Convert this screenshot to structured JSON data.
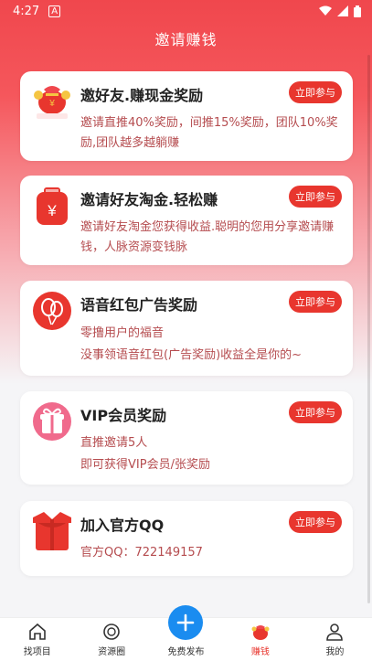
{
  "status": {
    "time": "4:27"
  },
  "header": {
    "title": "邀请赚钱"
  },
  "join_label": "立即参与",
  "cards": [
    {
      "title": "邀好友.赚现金奖励",
      "desc1": "邀请直推40%奖励，间推15%奖励，团队10%奖励,团队越多越躺赚",
      "desc2": ""
    },
    {
      "title": "邀请好友淘金.轻松赚",
      "desc1": "邀请好友淘金您获得收益.聪明的您用分享邀请赚钱，人脉资源变钱脉",
      "desc2": ""
    },
    {
      "title": "语音红包广告奖励",
      "desc1": "零撸用户的福音",
      "desc2": "没事领语音红包(广告奖励)收益全是你的~"
    },
    {
      "title": "VIP会员奖励",
      "desc1": "直推邀请5人",
      "desc2": "即可获得VIP会员/张奖励"
    },
    {
      "title": "加入官方QQ",
      "desc1": "官方QQ：722149157",
      "desc2": ""
    }
  ],
  "nav": [
    {
      "label": "找项目",
      "icon": "home-icon"
    },
    {
      "label": "资源圈",
      "icon": "circle-icon"
    },
    {
      "label": "免费发布",
      "icon": "plus-icon"
    },
    {
      "label": "赚钱",
      "icon": "money-bag-icon"
    },
    {
      "label": "我的",
      "icon": "user-icon"
    }
  ],
  "colors": {
    "accent": "#e8362e",
    "fab": "#1a8cf0",
    "desc": "#b54c4f"
  }
}
